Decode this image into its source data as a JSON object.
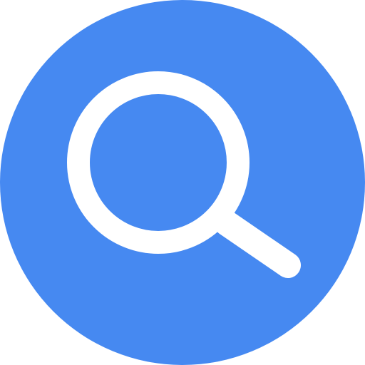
{
  "icon": {
    "name": "search-icon",
    "background_color": "#4689F1",
    "glyph_color": "#FFFFFF"
  }
}
